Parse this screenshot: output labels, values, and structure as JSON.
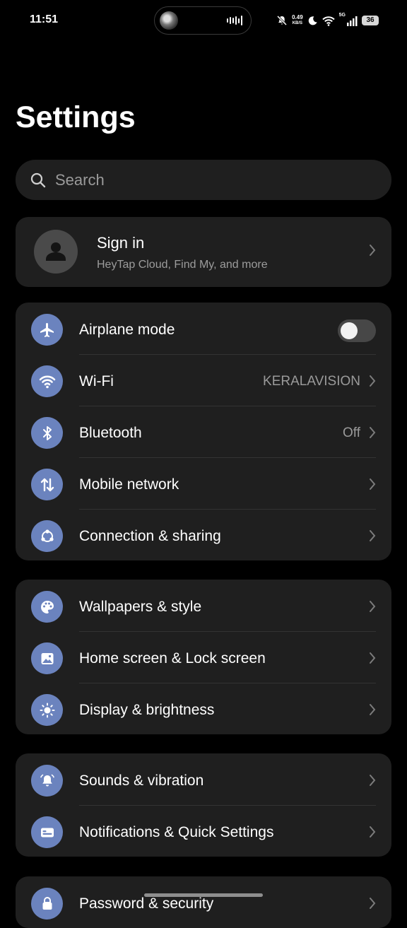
{
  "status_bar": {
    "time": "11:51",
    "net_speed_value": "0.49",
    "net_speed_unit": "KB/S",
    "network_type": "5G",
    "battery": "36",
    "icons": [
      "island-avatar",
      "audio-wave-icon",
      "mute-icon",
      "moon-icon",
      "wifi-icon",
      "signal-icon",
      "battery-icon"
    ]
  },
  "page": {
    "title": "Settings"
  },
  "search": {
    "placeholder": "Search"
  },
  "account": {
    "title": "Sign in",
    "subtitle": "HeyTap Cloud, Find My, and more"
  },
  "groups": [
    {
      "items": [
        {
          "label": "Airplane mode",
          "icon": "airplane-icon",
          "control": "toggle",
          "on": false
        },
        {
          "label": "Wi-Fi",
          "icon": "wifi-icon",
          "value": "KERALAVISION"
        },
        {
          "label": "Bluetooth",
          "icon": "bluetooth-icon",
          "value": "Off"
        },
        {
          "label": "Mobile network",
          "icon": "mobile-data-icon"
        },
        {
          "label": "Connection & sharing",
          "icon": "share-icon"
        }
      ]
    },
    {
      "items": [
        {
          "label": "Wallpapers & style",
          "icon": "palette-icon"
        },
        {
          "label": "Home screen & Lock screen",
          "icon": "home-screen-icon"
        },
        {
          "label": "Display & brightness",
          "icon": "brightness-icon"
        }
      ]
    },
    {
      "items": [
        {
          "label": "Sounds & vibration",
          "icon": "bell-icon"
        },
        {
          "label": "Notifications & Quick Settings",
          "icon": "notification-card-icon"
        }
      ]
    },
    {
      "items": [
        {
          "label": "Password & security",
          "icon": "lock-icon"
        }
      ]
    }
  ],
  "colors": {
    "background": "#000000",
    "card": "#1f1f1f",
    "icon_circle": "#6b83be",
    "secondary_text": "#9a9a9a"
  }
}
